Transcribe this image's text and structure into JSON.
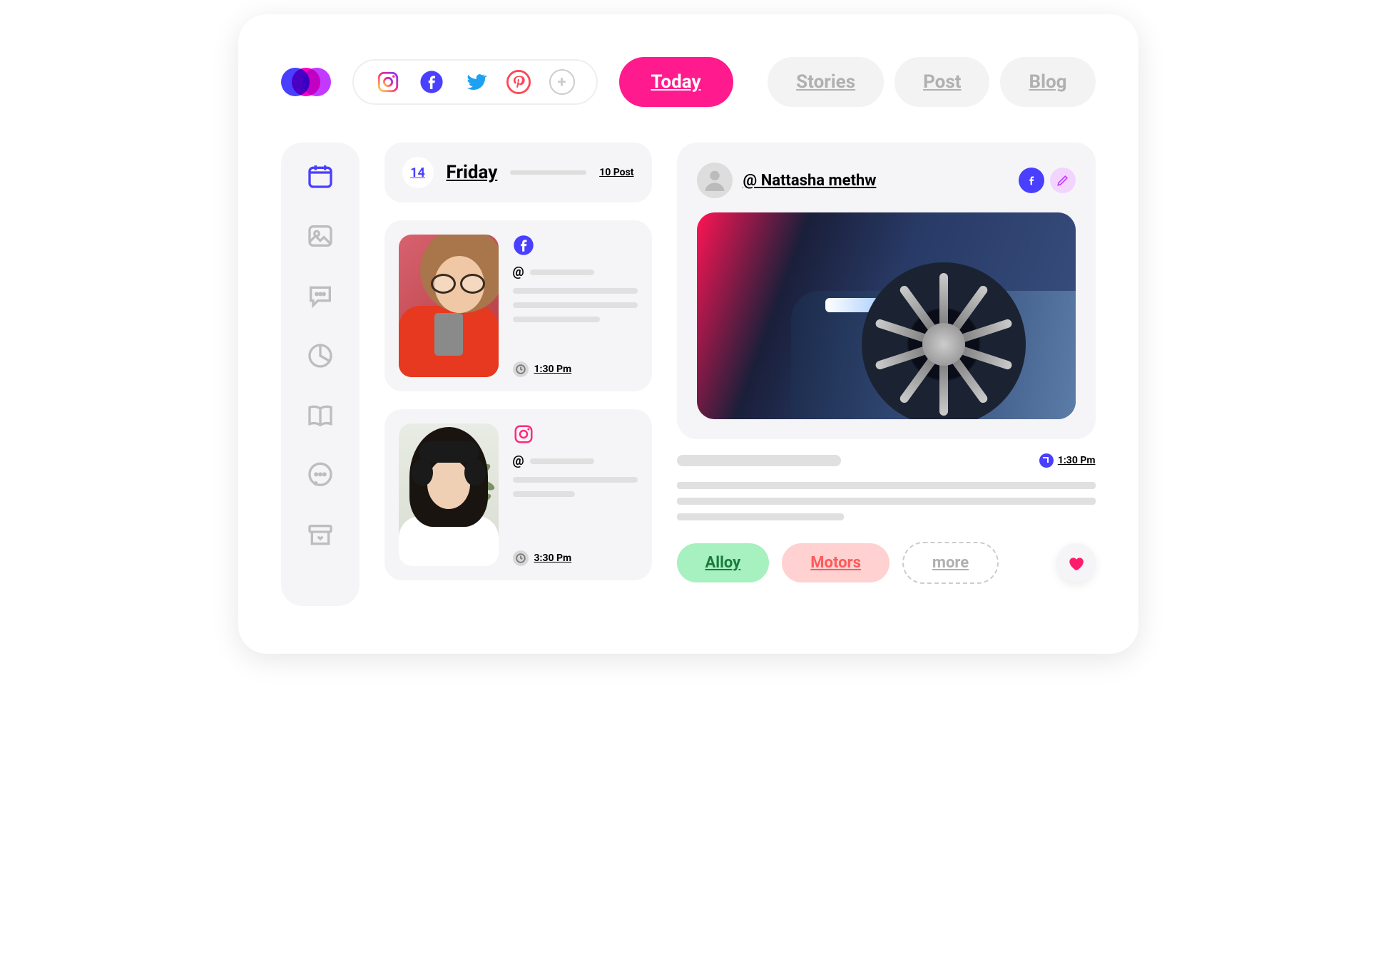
{
  "header": {
    "today_label": "Today",
    "tabs": [
      "Stories",
      "Post",
      "Blog"
    ]
  },
  "sidebar": {
    "items": [
      "calendar",
      "image",
      "comment",
      "chart",
      "book",
      "chat",
      "archive"
    ]
  },
  "day": {
    "num": "14",
    "name": "Friday",
    "count": "10 Post"
  },
  "posts": [
    {
      "network": "facebook",
      "handle": "@",
      "time": "1:30 Pm"
    },
    {
      "network": "instagram",
      "handle": "@",
      "time": "3:30 Pm"
    }
  ],
  "detail": {
    "username": "@ Nattasha methw",
    "time": "1:30 Pm",
    "tags": {
      "alloy": "Alloy",
      "motors": "Motors",
      "more": "more"
    }
  }
}
